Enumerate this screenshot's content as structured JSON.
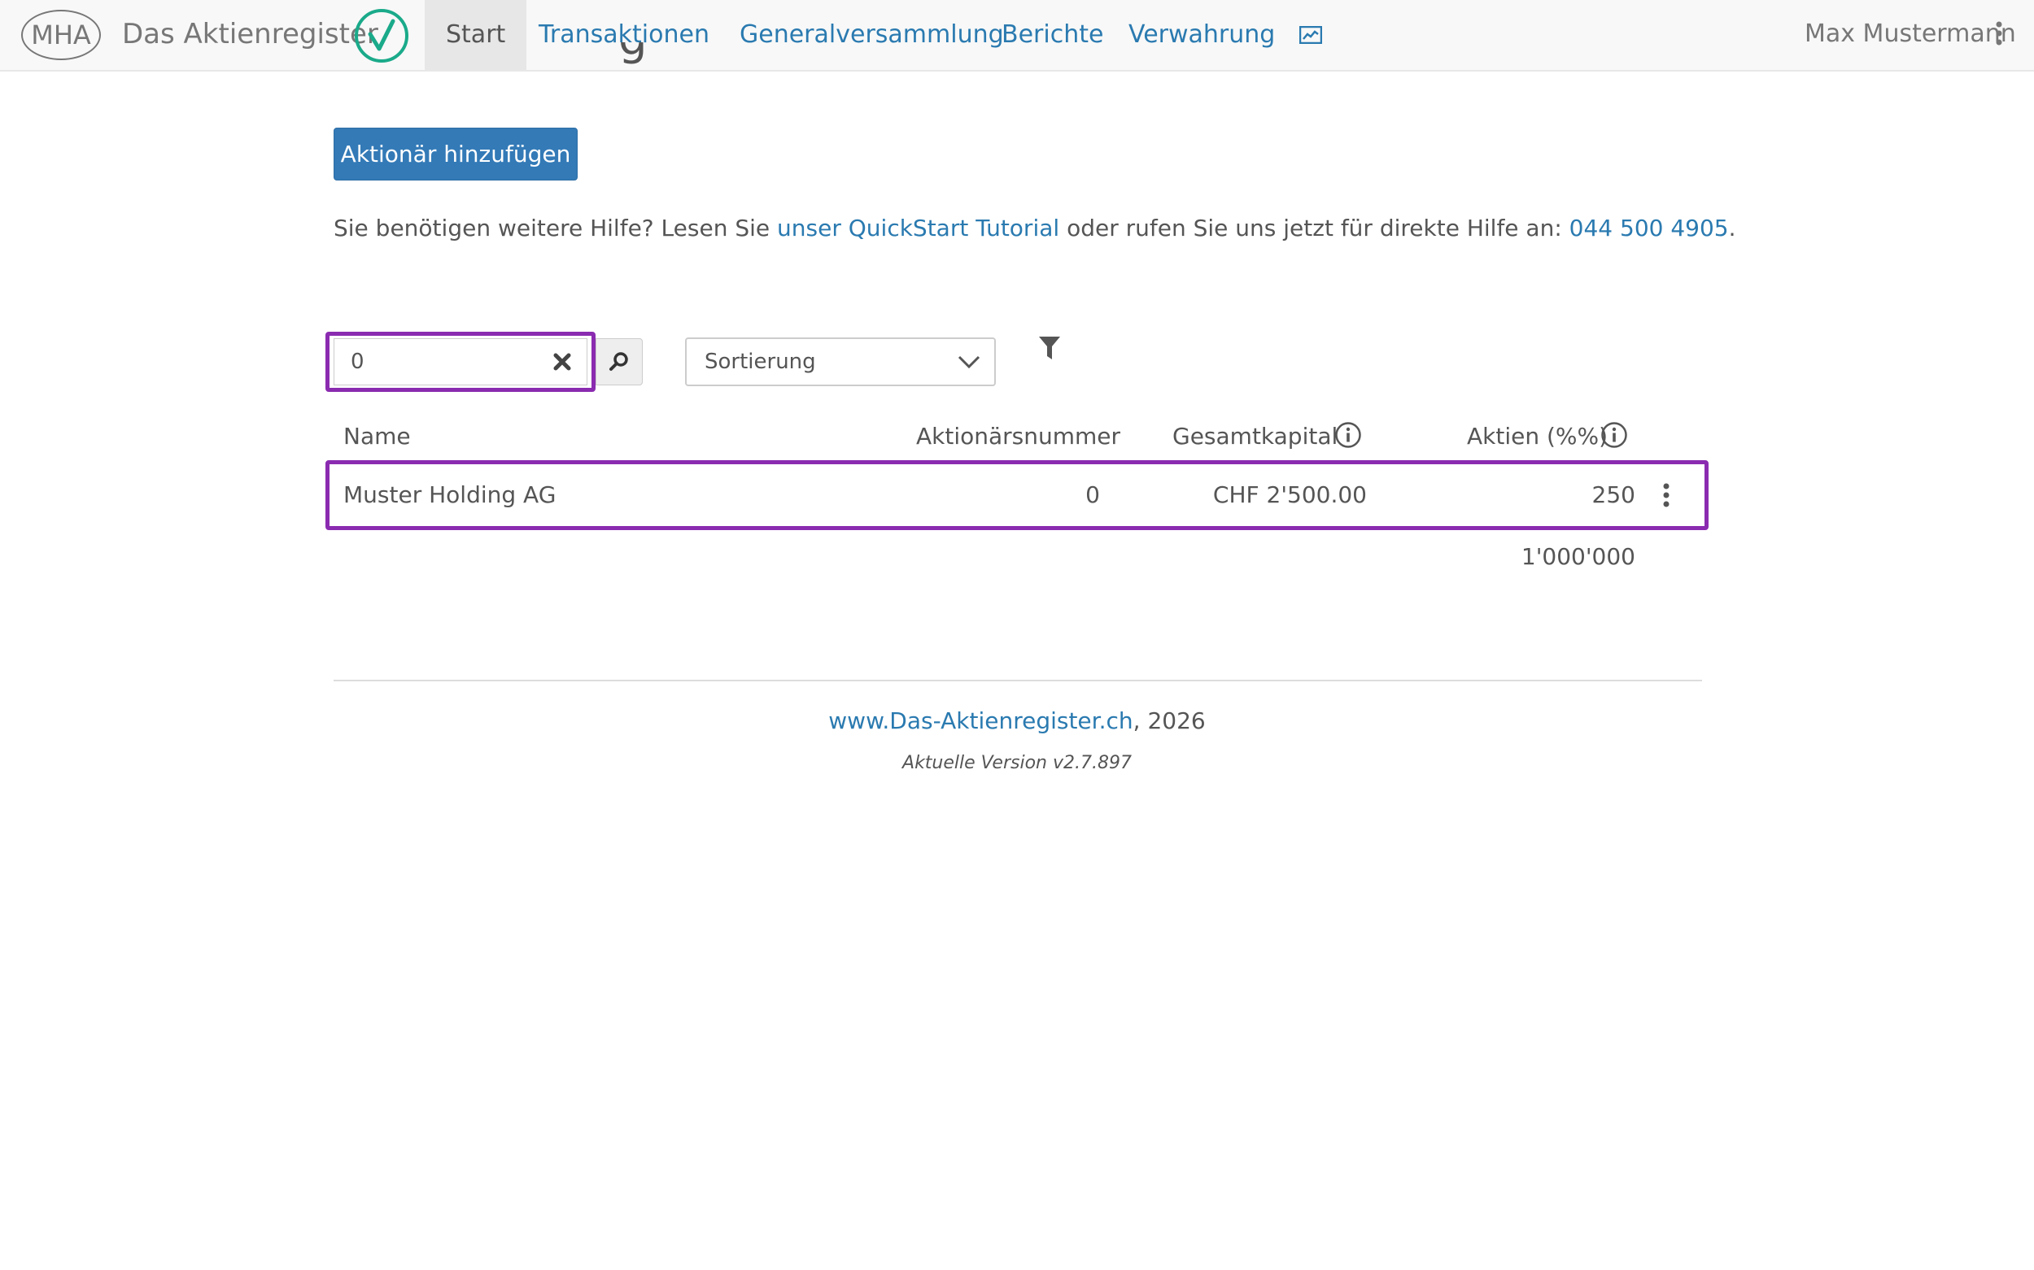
{
  "nav": {
    "logo_text": "MHA",
    "brand": "Das Aktienregister",
    "items": [
      {
        "label": "Start",
        "active": true
      },
      {
        "label": "Transaktionen",
        "active": false
      },
      {
        "label": "Generalversammlung",
        "active": false
      },
      {
        "label": "Berichte",
        "active": false
      },
      {
        "label": "Verwahrung",
        "active": false
      }
    ],
    "user_name": "Max Mustermann"
  },
  "main": {
    "partial_title": "g",
    "add_button": "Aktionär hinzufügen",
    "help": {
      "before": "Sie benötigen weitere Hilfe? Lesen Sie ",
      "tutorial_link": "unser QuickStart Tutorial",
      "middle": " oder rufen Sie uns jetzt für direkte Hilfe an: ",
      "phone_link": "044 500 4905",
      "after": "."
    },
    "search": {
      "value": "0"
    },
    "sort": {
      "selected": "Sortierung"
    }
  },
  "table": {
    "headers": {
      "name": "Name",
      "number": "Aktionärsnummer",
      "capital": "Gesamtkapital",
      "shares": "Aktien (%%)"
    },
    "rows": [
      {
        "name": "Muster Holding AG",
        "number": "0",
        "capital": "CHF 2'500.00",
        "shares": "250"
      }
    ],
    "total": "1'000'000"
  },
  "footer": {
    "link": "www.Das-Aktienregister.ch",
    "year": ", 2026",
    "version": "Aktuelle Version v2.7.897"
  },
  "colors": {
    "link": "#2a7ab0",
    "primary_button": "#337ab7",
    "highlight": "#8a2bb0",
    "check": "#1aaa8a"
  },
  "icons": [
    "check-circle-icon",
    "chart-icon",
    "more-vertical-icon",
    "clear-icon",
    "search-icon",
    "chevron-down-icon",
    "filter-icon",
    "info-icon"
  ]
}
